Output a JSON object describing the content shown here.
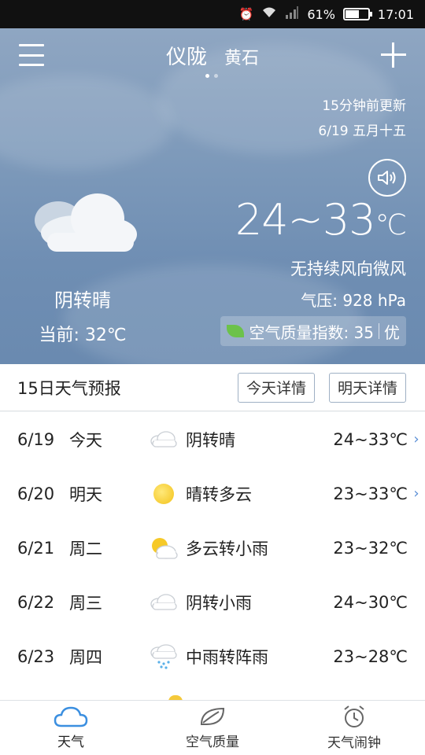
{
  "status_bar": {
    "battery": "61%",
    "time": "17:01",
    "battery_level": 0.61
  },
  "header": {
    "city_main": "仪陇",
    "city_sub": "黄石",
    "page_count": 2,
    "active_page": 1
  },
  "now": {
    "updated": "15分钟前更新",
    "date": "6/19 五月十五",
    "temp_range": "24~33",
    "temp_unit": "℃",
    "wind": "无持续风向微风",
    "pressure": "气压: 928 hPa",
    "aqi_label": "空气质量指数: 35",
    "aqi_level": "优",
    "condition": "阴转晴",
    "current": "当前: 32℃"
  },
  "forecast": {
    "title": "15日天气预报",
    "today_btn": "今天详情",
    "tomorrow_btn": "明天详情",
    "rows": [
      {
        "date": "6/19",
        "day": "今天",
        "icon": "overcast-icon",
        "desc": "阴转晴",
        "temp": "24~33℃",
        "chevron": true
      },
      {
        "date": "6/20",
        "day": "明天",
        "icon": "sun-icon",
        "desc": "晴转多云",
        "temp": "23~33℃",
        "chevron": true
      },
      {
        "date": "6/21",
        "day": "周二",
        "icon": "partly-cloudy-icon",
        "desc": "多云转小雨",
        "temp": "23~32℃",
        "chevron": false
      },
      {
        "date": "6/22",
        "day": "周三",
        "icon": "overcast-icon",
        "desc": "阴转小雨",
        "temp": "24~30℃",
        "chevron": false
      },
      {
        "date": "6/23",
        "day": "周四",
        "icon": "rain-icon",
        "desc": "中雨转阵雨",
        "temp": "23~28℃",
        "chevron": false
      }
    ]
  },
  "nav": {
    "weather": "天气",
    "air": "空气质量",
    "alarm": "天气闹钟"
  },
  "colors": {
    "accent": "#5b8fd6",
    "leaf": "#6cc24a",
    "sun": "#f3c21a"
  }
}
